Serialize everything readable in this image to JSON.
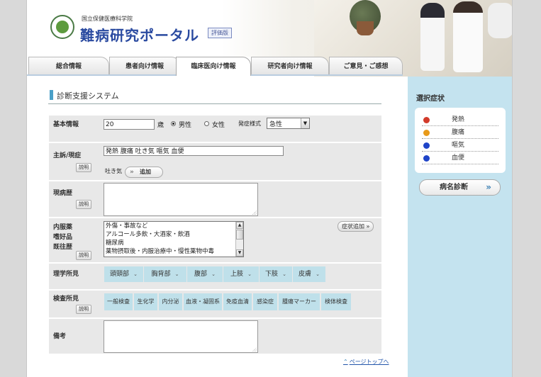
{
  "header": {
    "org_name": "国立保健医療科学院",
    "title": "難病研究ポータル",
    "badge": "評価版"
  },
  "tabs": [
    {
      "label": "総合情報",
      "active": false
    },
    {
      "label": "患者向け情報",
      "active": false
    },
    {
      "label": "臨床医向け情報",
      "active": true
    },
    {
      "label": "研究者向け情報",
      "active": false
    },
    {
      "label": "ご意見・ご感想",
      "active": false
    }
  ],
  "main": {
    "section_title": "診断支援システム",
    "basic": {
      "label": "基本情報",
      "age_value": "20",
      "age_unit": "歳",
      "male_label": "男性",
      "female_label": "女性",
      "selected_sex": "男性",
      "onset_label": "発症様式",
      "onset_value": "急性"
    },
    "complaint": {
      "label": "主訴/現症",
      "explain": "説明",
      "value": "発熱 腹痛 吐き気 嘔気 血便",
      "pending": "吐き気",
      "add_button": "追加"
    },
    "present_history": {
      "label": "現病歴",
      "explain": "説明"
    },
    "history": {
      "label1": "内服薬",
      "label2": "嗜好品",
      "label3": "既往歴",
      "explain": "説明",
      "options": [
        "外傷・事故など",
        "アルコール多飲・大酒家・飲酒",
        "糖尿病",
        "薬物摂取後・内服治療中・慢性薬物中毒"
      ],
      "add_button": "症状追加"
    },
    "physical": {
      "label": "理学所見",
      "items": [
        "頭頸部",
        "胸背部",
        "腹部",
        "上肢",
        "下肢",
        "皮膚"
      ]
    },
    "exam": {
      "label": "検査所見",
      "explain": "説明",
      "items": [
        "一般検査",
        "生化学",
        "内分泌",
        "血液・凝固系",
        "免疫血清",
        "感染症",
        "腫瘍マーカー",
        "検体検査"
      ]
    },
    "notes": {
      "label": "備考"
    },
    "page_top": "ページトップへ"
  },
  "sidebar": {
    "title": "選択症状",
    "symptoms": [
      {
        "label": "発熱",
        "icon": "red-dot-icon",
        "color": "#d23a2a"
      },
      {
        "label": "腹痛",
        "icon": "orange-warning-icon",
        "color": "#e89a1a"
      },
      {
        "label": "嘔気",
        "icon": "blue-dot-icon",
        "color": "#1f44c8"
      },
      {
        "label": "血便",
        "icon": "blue-dot-icon",
        "color": "#1f44c8"
      }
    ],
    "diagnose_button": "病名診断"
  }
}
